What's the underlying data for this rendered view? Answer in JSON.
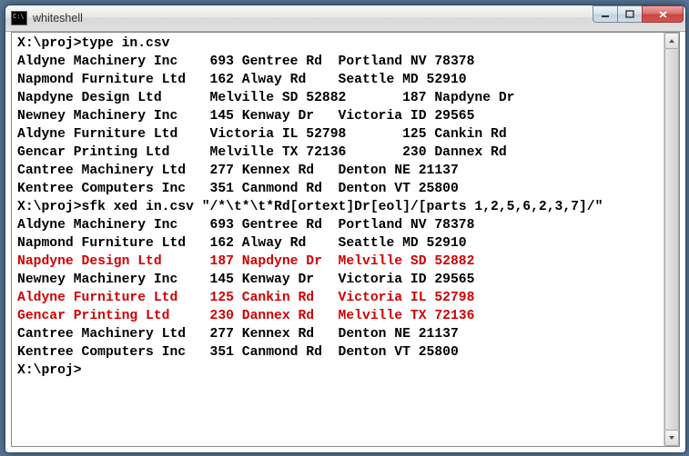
{
  "window": {
    "title": "whiteshell"
  },
  "terminal": {
    "prompt1": "X:\\proj>",
    "cmd1": "type in.csv",
    "block1": [
      "Aldyne Machinery Inc    693 Gentree Rd  Portland NV 78378",
      "Napmond Furniture Ltd   162 Alway Rd    Seattle MD 52910",
      "Napdyne Design Ltd      Melville SD 52882       187 Napdyne Dr",
      "Newney Machinery Inc    145 Kenway Dr   Victoria ID 29565",
      "Aldyne Furniture Ltd    Victoria IL 52798       125 Cankin Rd",
      "Gencar Printing Ltd     Melville TX 72136       230 Dannex Rd",
      "Cantree Machinery Ltd   277 Kennex Rd   Denton NE 21137",
      "Kentree Computers Inc   351 Canmond Rd  Denton VT 25800"
    ],
    "prompt2": "X:\\proj>",
    "cmd2": "sfk xed in.csv \"/*\\t*\\t*Rd[ortext]Dr[eol]/[parts 1,2,5,6,2,3,7]/\"",
    "block2": [
      {
        "text": "Aldyne Machinery Inc    693 Gentree Rd  Portland NV 78378",
        "red": false
      },
      {
        "text": "Napmond Furniture Ltd   162 Alway Rd    Seattle MD 52910",
        "red": false
      },
      {
        "text": "Napdyne Design Ltd      187 Napdyne Dr  Melville SD 52882",
        "red": true
      },
      {
        "text": "Newney Machinery Inc    145 Kenway Dr   Victoria ID 29565",
        "red": false
      },
      {
        "text": "Aldyne Furniture Ltd    125 Cankin Rd   Victoria IL 52798",
        "red": true
      },
      {
        "text": "Gencar Printing Ltd     230 Dannex Rd   Melville TX 72136",
        "red": true
      },
      {
        "text": "Cantree Machinery Ltd   277 Kennex Rd   Denton NE 21137",
        "red": false
      },
      {
        "text": "Kentree Computers Inc   351 Canmond Rd  Denton VT 25800",
        "red": false
      }
    ],
    "prompt3": "X:\\proj>"
  }
}
